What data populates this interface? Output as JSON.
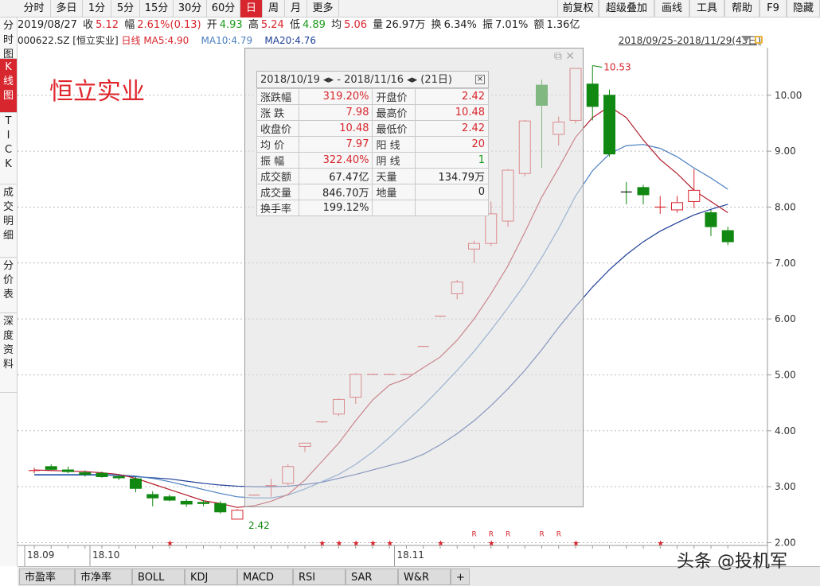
{
  "toolbar": {
    "left": [
      {
        "label": "分时",
        "w": 42
      },
      {
        "label": "多日",
        "w": 40
      },
      {
        "label": "1分",
        "w": 36
      },
      {
        "label": "5分",
        "w": 36
      },
      {
        "label": "15分",
        "w": 42
      },
      {
        "label": "30分",
        "w": 42
      },
      {
        "label": "60分",
        "w": 42
      },
      {
        "label": "日",
        "w": 28,
        "active": true
      },
      {
        "label": "周",
        "w": 28
      },
      {
        "label": "月",
        "w": 28
      },
      {
        "label": "更多",
        "w": 40
      }
    ],
    "right": [
      {
        "label": "前复权",
        "w": 52
      },
      {
        "label": "超级叠加",
        "w": 70
      },
      {
        "label": "画线",
        "w": 44
      },
      {
        "label": "工具",
        "w": 44
      },
      {
        "label": "帮助",
        "w": 44
      },
      {
        "label": "F9",
        "w": 34
      },
      {
        "label": "隐藏",
        "w": 42
      }
    ]
  },
  "info": {
    "date": "2019/08/27",
    "close_label": "收",
    "close": "5.12",
    "change_label": "幅",
    "change": "2.61%(0.13)",
    "open_label": "开",
    "open": "4.93",
    "high_label": "高",
    "high": "5.24",
    "low_label": "低",
    "low": "4.89",
    "avg_label": "均",
    "avg": "5.06",
    "vol_label": "量",
    "vol": "26.97万",
    "turnover_label": "换",
    "turnover": "6.34%",
    "amp_label": "振",
    "amp": "7.01%",
    "amount_label": "额",
    "amount": "1.36亿"
  },
  "ma": {
    "code": "000622.SZ [恒立实业]",
    "period": "日线",
    "ma5": "MA5:4.90",
    "ma10": "MA10:4.79",
    "ma20": "MA20:4.76",
    "range": "2018/09/25-2018/11/29(43日)"
  },
  "left_tabs": [
    {
      "label": "分时图",
      "active": false
    },
    {
      "label": "K线图",
      "active": true
    },
    {
      "label": "TICK",
      "active": false
    },
    {
      "label": "成交明细",
      "active": false
    },
    {
      "label": "分价表",
      "active": false
    },
    {
      "label": "深度资料",
      "active": false
    }
  ],
  "stock_title": "恒立实业",
  "stats": {
    "header": "2018/10/19 ◂▸ - 2018/11/16 ◂▸  (21日)",
    "close_x": "×",
    "rows": [
      [
        "涨跌幅",
        "319.20%",
        "开盘价",
        "2.42"
      ],
      [
        "涨  跌",
        "7.98",
        "最高价",
        "10.48"
      ],
      [
        "收盘价",
        "10.48",
        "最低价",
        "2.42"
      ],
      [
        "均  价",
        "7.97",
        "阳  线",
        "20"
      ],
      [
        "振  幅",
        "322.40%",
        "阴  线",
        "1"
      ],
      [
        "成交额",
        "67.47亿",
        "天量",
        "134.79万"
      ],
      [
        "成交量",
        "846.70万",
        "地量",
        "0"
      ],
      [
        "换手率",
        "199.12%",
        "",
        ""
      ]
    ]
  },
  "chart_data": {
    "type": "candlestick",
    "y_axis_labels": [
      "10.00",
      "9.00",
      "8.00",
      "7.00",
      "6.00",
      "5.00",
      "4.00",
      "3.00",
      "2.00"
    ],
    "ylim": [
      1.95,
      10.85
    ],
    "x_labels": [
      {
        "label": "18.09",
        "index": 0
      },
      {
        "label": "18.10",
        "index": 4
      },
      {
        "label": "18.11",
        "index": 22
      }
    ],
    "candles": [
      {
        "o": 3.28,
        "h": 3.34,
        "l": 3.24,
        "c": 3.29
      },
      {
        "o": 3.36,
        "h": 3.4,
        "l": 3.3,
        "c": 3.31
      },
      {
        "o": 3.3,
        "h": 3.36,
        "l": 3.24,
        "c": 3.27
      },
      {
        "o": 3.25,
        "h": 3.29,
        "l": 3.18,
        "c": 3.22
      },
      {
        "o": 3.24,
        "h": 3.27,
        "l": 3.16,
        "c": 3.18
      },
      {
        "o": 3.18,
        "h": 3.22,
        "l": 3.12,
        "c": 3.16
      },
      {
        "o": 3.14,
        "h": 3.18,
        "l": 2.9,
        "c": 2.97
      },
      {
        "o": 2.86,
        "h": 2.92,
        "l": 2.65,
        "c": 2.8
      },
      {
        "o": 2.82,
        "h": 2.86,
        "l": 2.74,
        "c": 2.76
      },
      {
        "o": 2.74,
        "h": 2.78,
        "l": 2.64,
        "c": 2.69
      },
      {
        "o": 2.72,
        "h": 2.76,
        "l": 2.65,
        "c": 2.7
      },
      {
        "o": 2.7,
        "h": 2.74,
        "l": 2.52,
        "c": 2.55
      },
      {
        "o": 2.42,
        "h": 2.6,
        "l": 2.42,
        "c": 2.58
      },
      {
        "o": 2.84,
        "h": 2.85,
        "l": 2.84,
        "c": 2.85
      },
      {
        "o": 3.01,
        "h": 3.14,
        "l": 2.82,
        "c": 3.02
      },
      {
        "o": 3.06,
        "h": 3.4,
        "l": 3.02,
        "c": 3.36
      },
      {
        "o": 3.72,
        "h": 3.78,
        "l": 3.62,
        "c": 3.78
      },
      {
        "o": 4.15,
        "h": 4.16,
        "l": 4.14,
        "c": 4.16
      },
      {
        "o": 4.3,
        "h": 4.58,
        "l": 4.26,
        "c": 4.56
      },
      {
        "o": 4.6,
        "h": 5.03,
        "l": 4.48,
        "c": 5.01
      },
      {
        "o": 5.01,
        "h": 5.02,
        "l": 5.0,
        "c": 5.01
      },
      {
        "o": 5.01,
        "h": 5.02,
        "l": 5.0,
        "c": 5.01
      },
      {
        "o": 5.01,
        "h": 5.02,
        "l": 5.0,
        "c": 5.01
      },
      {
        "o": 5.5,
        "h": 5.52,
        "l": 5.5,
        "c": 5.51
      },
      {
        "o": 6.05,
        "h": 6.06,
        "l": 6.04,
        "c": 6.05
      },
      {
        "o": 6.45,
        "h": 6.7,
        "l": 6.35,
        "c": 6.66
      },
      {
        "o": 7.25,
        "h": 7.4,
        "l": 7.0,
        "c": 7.35
      },
      {
        "o": 7.35,
        "h": 8.1,
        "l": 7.3,
        "c": 7.88
      },
      {
        "o": 7.75,
        "h": 8.68,
        "l": 7.65,
        "c": 8.66
      },
      {
        "o": 8.6,
        "h": 9.56,
        "l": 8.55,
        "c": 9.54
      },
      {
        "o": 10.18,
        "h": 10.28,
        "l": 8.7,
        "c": 9.82
      },
      {
        "o": 9.3,
        "h": 9.62,
        "l": 9.1,
        "c": 9.52
      },
      {
        "o": 9.55,
        "h": 10.48,
        "l": 9.5,
        "c": 10.48
      },
      {
        "o": 10.2,
        "h": 10.53,
        "l": 9.55,
        "c": 9.8
      },
      {
        "o": 10.0,
        "h": 10.1,
        "l": 8.9,
        "c": 8.95
      },
      {
        "o": 8.27,
        "h": 8.45,
        "l": 8.05,
        "c": 8.26
      },
      {
        "o": 8.35,
        "h": 8.4,
        "l": 8.05,
        "c": 8.22
      },
      {
        "o": 8.0,
        "h": 8.2,
        "l": 7.88,
        "c": 8.0
      },
      {
        "o": 7.95,
        "h": 8.2,
        "l": 7.9,
        "c": 8.08
      },
      {
        "o": 8.1,
        "h": 8.68,
        "l": 7.98,
        "c": 8.3
      },
      {
        "o": 7.9,
        "h": 7.95,
        "l": 7.48,
        "c": 7.65
      },
      {
        "o": 7.58,
        "h": 7.65,
        "l": 7.32,
        "c": 7.38
      }
    ],
    "ma5": [
      3.3,
      3.29,
      3.28,
      3.27,
      3.25,
      3.22,
      3.15,
      3.05,
      2.95,
      2.85,
      2.75,
      2.7,
      2.63,
      2.66,
      2.74,
      2.86,
      3.12,
      3.45,
      3.78,
      4.18,
      4.55,
      4.82,
      4.93,
      5.13,
      5.32,
      5.62,
      6.0,
      6.45,
      6.95,
      7.55,
      8.18,
      8.7,
      9.25,
      9.6,
      9.8,
      9.6,
      9.2,
      8.85,
      8.6,
      8.3,
      8.1,
      7.9
    ],
    "ma10": [
      3.22,
      3.22,
      3.22,
      3.22,
      3.22,
      3.21,
      3.19,
      3.15,
      3.09,
      3.02,
      2.95,
      2.88,
      2.82,
      2.8,
      2.8,
      2.85,
      2.96,
      3.09,
      3.22,
      3.4,
      3.62,
      3.88,
      4.17,
      4.45,
      4.76,
      5.08,
      5.42,
      5.8,
      6.2,
      6.62,
      7.1,
      7.62,
      8.2,
      8.65,
      8.95,
      9.1,
      9.12,
      9.05,
      8.9,
      8.7,
      8.52,
      8.32
    ],
    "ma20": [
      3.21,
      3.21,
      3.21,
      3.21,
      3.21,
      3.2,
      3.18,
      3.16,
      3.14,
      3.1,
      3.06,
      3.03,
      3.01,
      3.0,
      3.0,
      3.01,
      3.04,
      3.08,
      3.15,
      3.22,
      3.3,
      3.38,
      3.46,
      3.58,
      3.75,
      3.95,
      4.18,
      4.45,
      4.75,
      5.08,
      5.45,
      5.85,
      6.22,
      6.57,
      6.88,
      7.15,
      7.38,
      7.57,
      7.72,
      7.86,
      7.96,
      8.05
    ],
    "high_label": "10.53",
    "low_label": "2.42",
    "star_indices": [
      8,
      17,
      18,
      19,
      20,
      21,
      24,
      27,
      32,
      37
    ],
    "r_indices": [
      26,
      27,
      28,
      30,
      31
    ]
  },
  "bottom_tabs": [
    "市盈率",
    "市净率",
    "BOLL",
    "KDJ",
    "MACD",
    "RSI",
    "SAR",
    "W&R",
    "+"
  ],
  "watermark": "头条 @投机军"
}
